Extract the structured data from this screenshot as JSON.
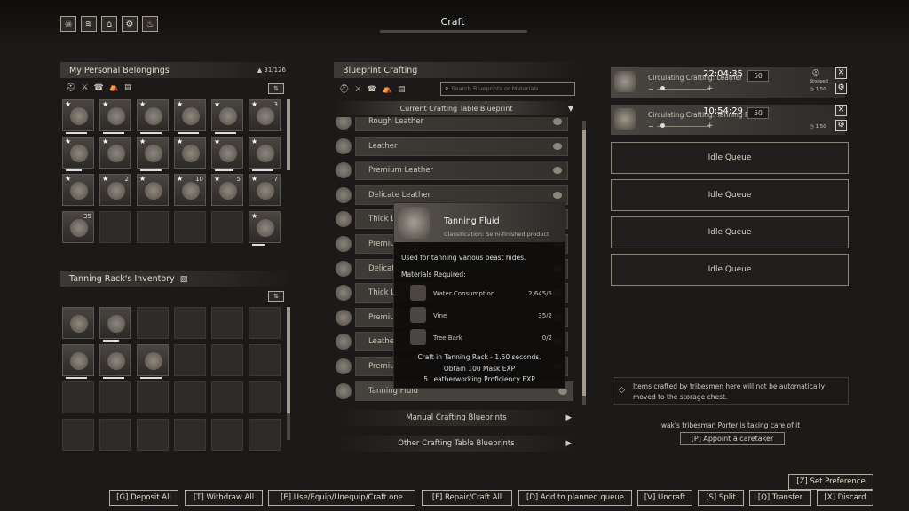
{
  "top_icons": [
    "skull-icon",
    "scroll-icon",
    "bag-icon",
    "gear-icon",
    "flame-icon"
  ],
  "header": {
    "title": "Craft"
  },
  "belongings": {
    "title": "My Personal Belongings",
    "capacity": "31/126",
    "filters": [
      "helmet-filter-icon",
      "sword-filter-icon",
      "hood-filter-icon",
      "tent-filter-icon",
      "book-filter-icon"
    ],
    "slots": [
      {
        "star": true,
        "count": "",
        "dur": 0.8
      },
      {
        "star": true,
        "count": "",
        "dur": 0.8
      },
      {
        "star": true,
        "count": "",
        "dur": 0.8
      },
      {
        "star": true,
        "count": "",
        "dur": 0.8
      },
      {
        "star": true,
        "count": "",
        "dur": 0.8
      },
      {
        "star": true,
        "count": "3",
        "dur": 0
      },
      {
        "star": true,
        "count": "",
        "dur": 0.6
      },
      {
        "star": true,
        "count": "",
        "dur": 0
      },
      {
        "star": true,
        "count": "",
        "dur": 0.8
      },
      {
        "star": true,
        "count": "",
        "dur": 0
      },
      {
        "star": true,
        "count": "",
        "dur": 0.7
      },
      {
        "star": true,
        "count": "",
        "dur": 0.8
      },
      {
        "star": true,
        "count": "",
        "dur": 0
      },
      {
        "star": true,
        "count": "2",
        "dur": 0
      },
      {
        "star": true,
        "count": "",
        "dur": 0
      },
      {
        "star": true,
        "count": "10",
        "dur": 0
      },
      {
        "star": true,
        "count": "5",
        "dur": 0
      },
      {
        "star": true,
        "count": "7",
        "dur": 0
      },
      {
        "star": false,
        "count": "35",
        "dur": 0
      },
      {
        "star": false,
        "count": "",
        "dur": -1
      },
      {
        "star": false,
        "count": "",
        "dur": -1
      },
      {
        "star": false,
        "count": "",
        "dur": -1
      },
      {
        "star": false,
        "count": "",
        "dur": -1
      },
      {
        "star": true,
        "count": "",
        "dur": 0.5
      }
    ]
  },
  "tanning_rack": {
    "title": "Tanning Rack's Inventory",
    "slots": [
      {
        "star": false,
        "count": "",
        "dur": 0
      },
      {
        "star": false,
        "count": "",
        "dur": 0.6
      },
      {
        "star": false,
        "count": "",
        "dur": -1
      },
      {
        "star": false,
        "count": "",
        "dur": -1
      },
      {
        "star": false,
        "count": "",
        "dur": -1
      },
      {
        "star": false,
        "count": "",
        "dur": -1
      },
      {
        "star": false,
        "count": "",
        "dur": 0.8
      },
      {
        "star": false,
        "count": "",
        "dur": 0.8
      },
      {
        "star": false,
        "count": "",
        "dur": 0.8
      }
    ]
  },
  "blueprint": {
    "title": "Blueprint Crafting",
    "search_placeholder": "Search Blueprints or Materials",
    "current_table": "Current Crafting Table Blueprint",
    "items": [
      "Rough Leather",
      "Leather",
      "Premium Leather",
      "Delicate Leather",
      "Thick Le",
      "Premiu",
      "Delicat",
      "Thick Le",
      "Premiu",
      "Leather",
      "Premiu",
      "Tanning Fluid"
    ],
    "manual": "Manual Crafting Blueprints",
    "other": "Other Crafting Table Blueprints"
  },
  "tooltip": {
    "name": "Tanning Fluid",
    "classification": "Classification: Semi-finished product",
    "description": "Used for tanning various beast hides.",
    "materials_title": "Materials Required:",
    "materials": [
      {
        "name": "Water Consumption",
        "qty": "2,645/5"
      },
      {
        "name": "Vine",
        "qty": "35/2"
      },
      {
        "name": "Tree Bark",
        "qty": "0/2"
      }
    ],
    "craft_info": [
      "Craft in Tanning Rack - 1.50 seconds.",
      "Obtain 100 Mask EXP",
      "5 Leatherworking Proficiency EXP"
    ]
  },
  "queue": {
    "active": [
      {
        "name": "Circulating Crafting: Leather",
        "timer": "22:04:35",
        "qty": "50",
        "status": "Stopped",
        "rate": "1.50"
      },
      {
        "name": "Circulating Crafting: Tanning Fluid",
        "timer": "10:54:29",
        "qty": "50",
        "status": "",
        "rate": "1.50"
      }
    ],
    "idle_label": "Idle Queue",
    "idle_count": 4,
    "notice": "Items crafted by tribesmen here will not be automatically moved to the storage chest.",
    "caretaker_status": "wak's tribesman Porter is taking care of it",
    "appoint_button": "[P]  Appoint a caretaker"
  },
  "buttons": {
    "set_preference": "[Z]  Set Preference",
    "deposit_all": "[G]  Deposit All",
    "withdraw_all": "[T]  Withdraw All",
    "use_equip": "[E]  Use/Equip/Unequip/Craft one",
    "repair_craft": "[F]  Repair/Craft All",
    "add_queue": "[D]  Add to planned queue",
    "uncraft": "[V]  Uncraft",
    "split": "[S]  Split",
    "transfer": "[Q]  Transfer",
    "discard": "[X]  Discard"
  }
}
